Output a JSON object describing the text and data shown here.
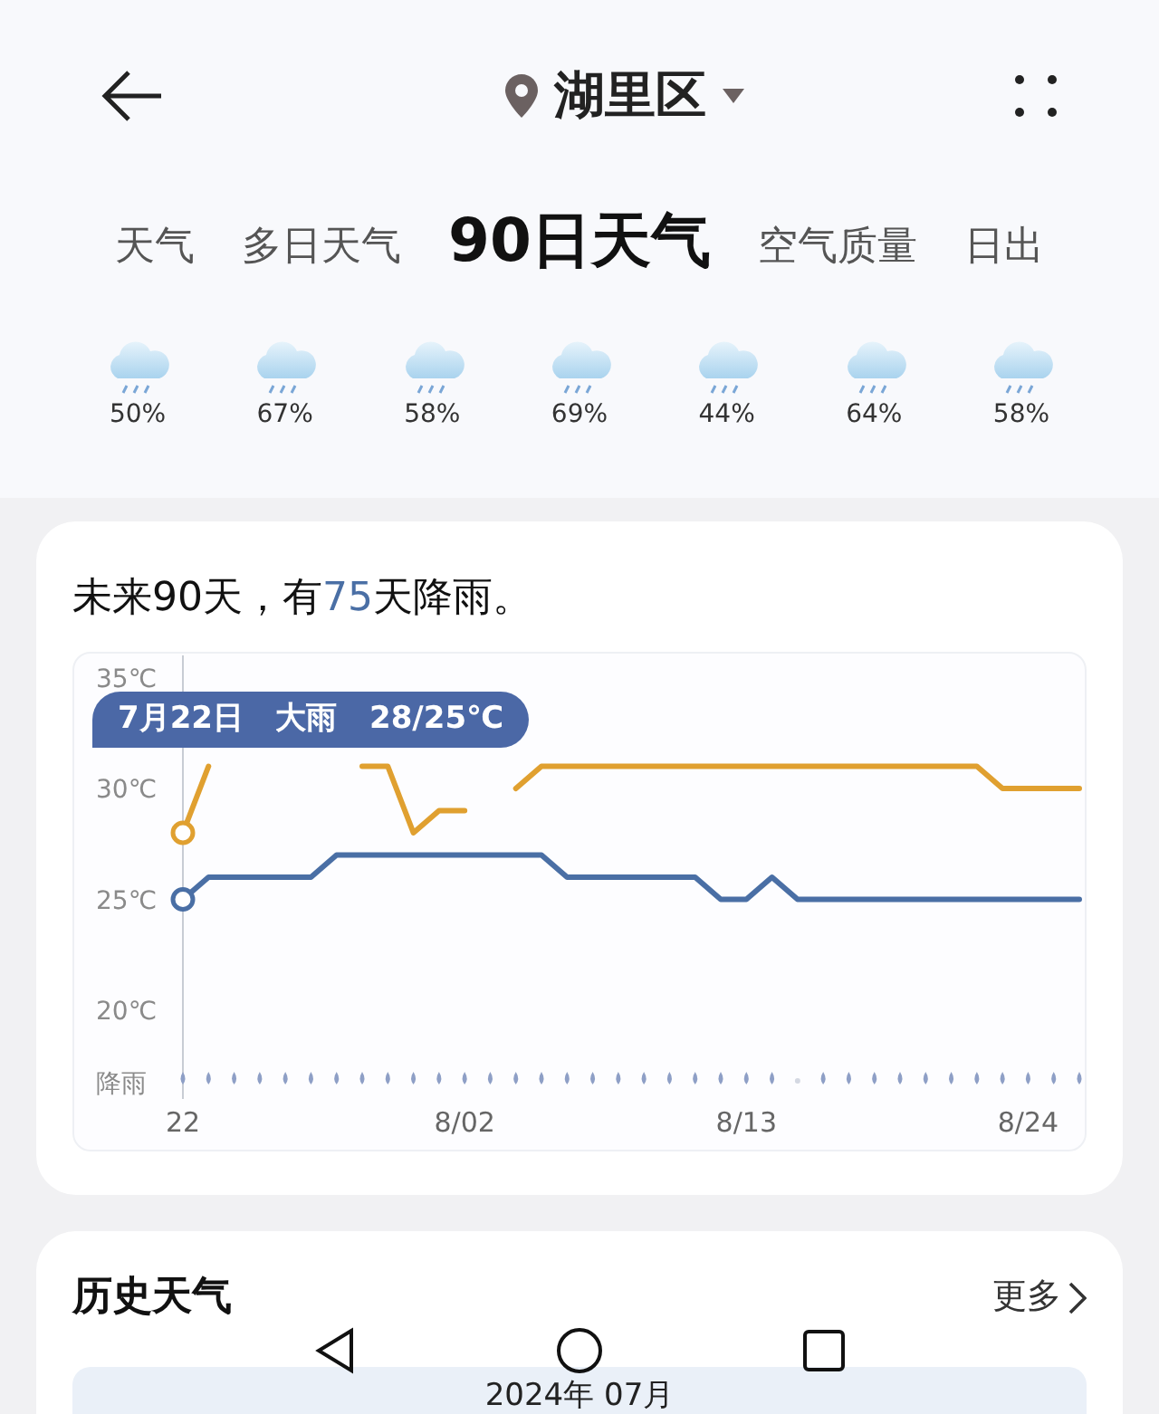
{
  "header": {
    "location": "湖里区"
  },
  "tabs": [
    {
      "label": "天气",
      "selected": false
    },
    {
      "label": "多日天气",
      "selected": false
    },
    {
      "label": "90日天气",
      "selected": true
    },
    {
      "label": "空气质量",
      "selected": false
    },
    {
      "label": "日出",
      "selected": false
    }
  ],
  "rain_chances": [
    {
      "percent": "50%"
    },
    {
      "percent": "67%"
    },
    {
      "percent": "58%"
    },
    {
      "percent": "69%"
    },
    {
      "percent": "44%"
    },
    {
      "percent": "64%"
    },
    {
      "percent": "58%"
    }
  ],
  "forecast_card": {
    "summary": {
      "before": "未来90天，有",
      "count": "75",
      "after": "天降雨。"
    },
    "tooltip": "7月22日   大雨   28/25℃",
    "rain_label": "降雨",
    "rain_days": [
      true,
      true,
      true,
      true,
      true,
      true,
      true,
      true,
      true,
      true,
      true,
      true,
      true,
      true,
      true,
      true,
      true,
      true,
      true,
      true,
      true,
      true,
      true,
      true,
      false,
      true,
      true,
      true,
      true,
      true,
      true,
      true,
      true,
      true,
      true,
      true
    ],
    "chart_data": {
      "type": "line",
      "categories": [
        "22",
        null,
        null,
        null,
        null,
        null,
        null,
        null,
        null,
        null,
        null,
        "8/02",
        null,
        null,
        null,
        null,
        null,
        null,
        null,
        null,
        null,
        null,
        "8/13",
        null,
        null,
        null,
        null,
        null,
        null,
        null,
        null,
        null,
        null,
        "8/24",
        null,
        null
      ],
      "series": [
        {
          "color": "#e0a030",
          "values": [
            28,
            31,
            null,
            null,
            null,
            null,
            null,
            31,
            31,
            28,
            29,
            29,
            null,
            30,
            31,
            31,
            31,
            31,
            31,
            31,
            31,
            31,
            31,
            31,
            31,
            31,
            31,
            31,
            31,
            31,
            31,
            31,
            30,
            30,
            30,
            30
          ]
        },
        {
          "color": "#4a6fa5",
          "values": [
            25,
            26,
            26,
            26,
            26,
            26,
            27,
            27,
            27,
            27,
            27,
            27,
            27,
            27,
            27,
            26,
            26,
            26,
            26,
            26,
            26,
            25,
            25,
            26,
            25,
            25,
            25,
            25,
            25,
            25,
            25,
            25,
            25,
            25,
            25,
            25
          ]
        }
      ],
      "ylim": [
        16,
        36
      ],
      "yticks": [
        {
          "value": 35,
          "label": "35℃"
        },
        {
          "value": 30,
          "label": "30℃"
        },
        {
          "value": 25,
          "label": "25℃"
        },
        {
          "value": 20,
          "label": "20℃"
        }
      ]
    }
  },
  "history_card": {
    "title": "历史天气",
    "more": "更多",
    "month": "2024年 07月"
  }
}
